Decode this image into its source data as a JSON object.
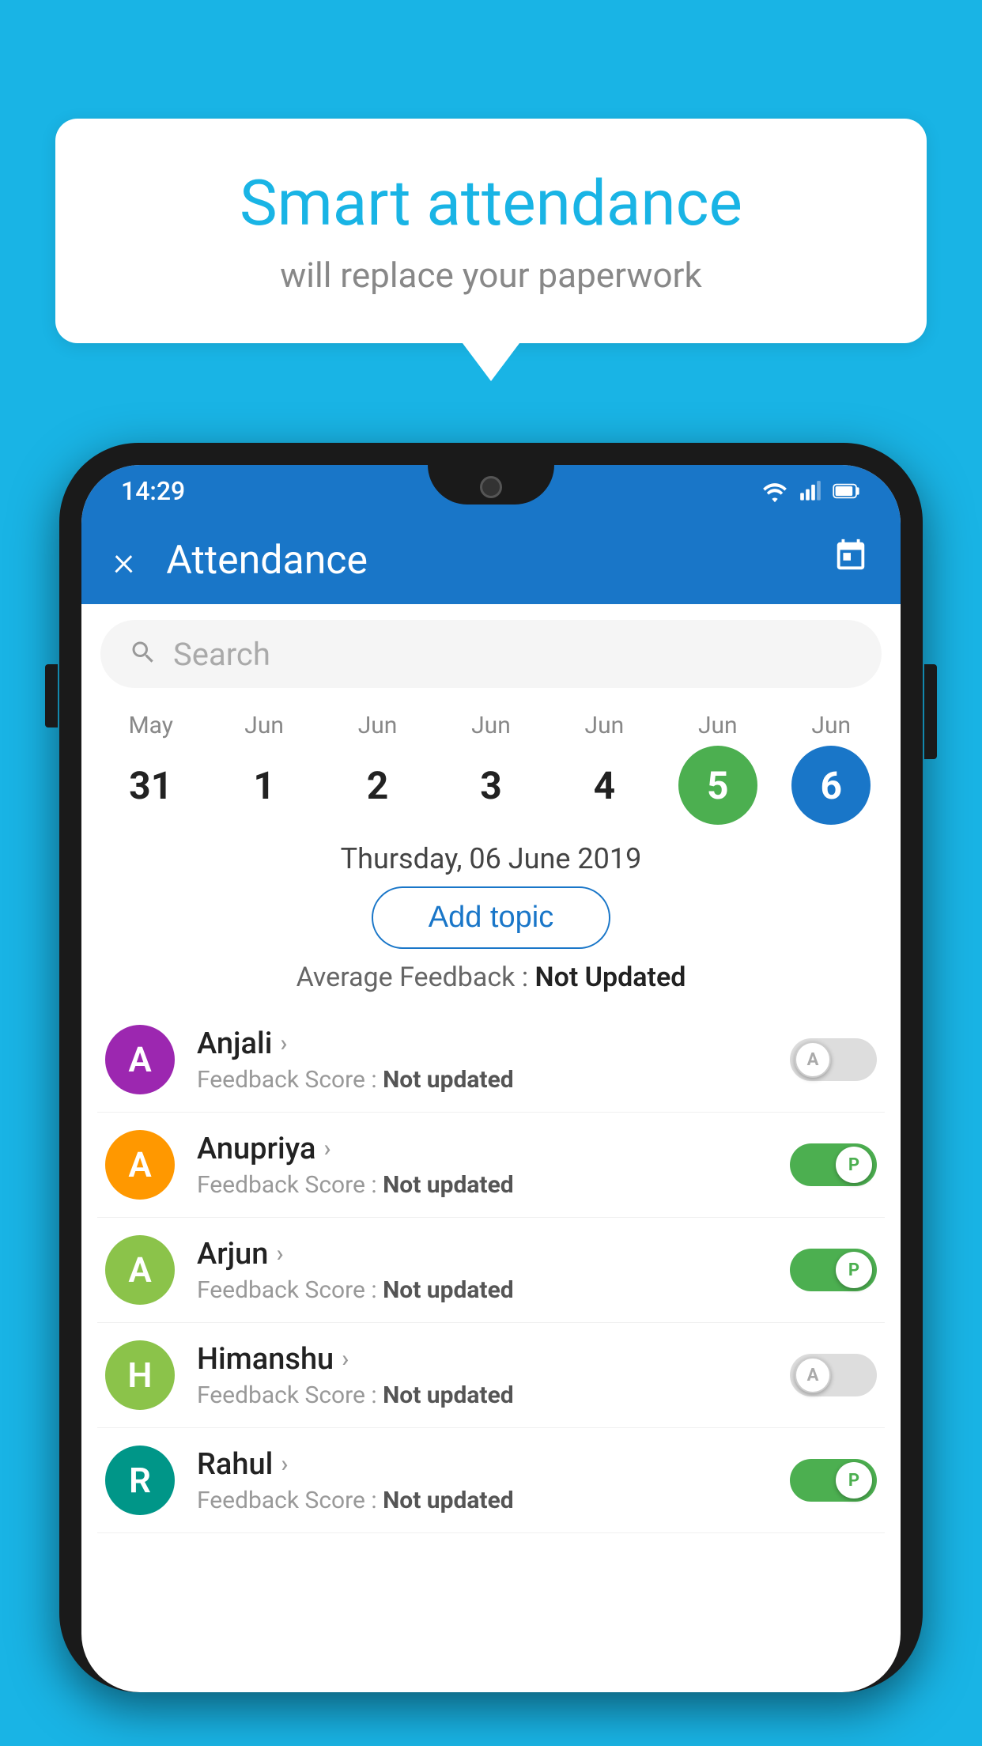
{
  "background": "#19B4E5",
  "bubble": {
    "title": "Smart attendance",
    "subtitle": "will replace your paperwork"
  },
  "status_bar": {
    "time": "14:29",
    "icons": [
      "wifi",
      "signal",
      "battery"
    ]
  },
  "app_bar": {
    "title": "Attendance",
    "close_label": "×",
    "calendar_label": "📅"
  },
  "search": {
    "placeholder": "Search"
  },
  "calendar": {
    "days": [
      {
        "month": "May",
        "date": "31",
        "highlight": ""
      },
      {
        "month": "Jun",
        "date": "1",
        "highlight": ""
      },
      {
        "month": "Jun",
        "date": "2",
        "highlight": ""
      },
      {
        "month": "Jun",
        "date": "3",
        "highlight": ""
      },
      {
        "month": "Jun",
        "date": "4",
        "highlight": ""
      },
      {
        "month": "Jun",
        "date": "5",
        "highlight": "green"
      },
      {
        "month": "Jun",
        "date": "6",
        "highlight": "blue"
      }
    ],
    "selected_date": "Thursday, 06 June 2019"
  },
  "add_topic_label": "Add topic",
  "avg_feedback": {
    "label": "Average Feedback : ",
    "value": "Not Updated"
  },
  "students": [
    {
      "name": "Anjali",
      "initial": "A",
      "avatar_color": "av-purple",
      "feedback_label": "Feedback Score : ",
      "feedback_value": "Not updated",
      "toggle": "off",
      "toggle_label": "A"
    },
    {
      "name": "Anupriya",
      "initial": "A",
      "avatar_color": "av-orange",
      "feedback_label": "Feedback Score : ",
      "feedback_value": "Not updated",
      "toggle": "on",
      "toggle_label": "P"
    },
    {
      "name": "Arjun",
      "initial": "A",
      "avatar_color": "av-green",
      "feedback_label": "Feedback Score : ",
      "feedback_value": "Not updated",
      "toggle": "on",
      "toggle_label": "P"
    },
    {
      "name": "Himanshu",
      "initial": "H",
      "avatar_color": "av-lightgreen",
      "feedback_label": "Feedback Score : ",
      "feedback_value": "Not updated",
      "toggle": "off",
      "toggle_label": "A"
    },
    {
      "name": "Rahul",
      "initial": "R",
      "avatar_color": "av-teal",
      "feedback_label": "Feedback Score : ",
      "feedback_value": "Not updated",
      "toggle": "on",
      "toggle_label": "P"
    }
  ]
}
